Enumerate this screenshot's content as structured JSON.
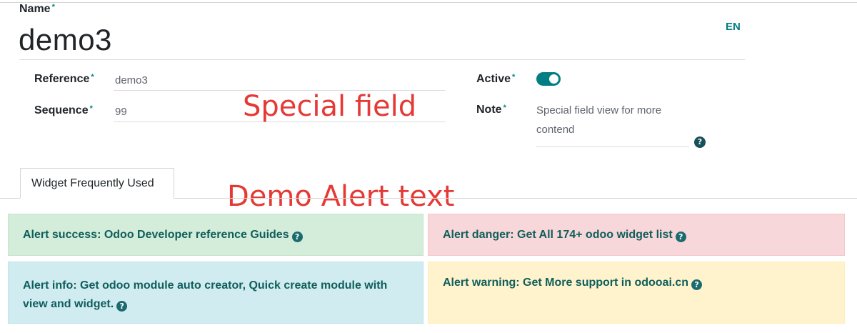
{
  "form": {
    "name_label": "Name",
    "name_value": "demo3",
    "lang_button": "EN",
    "required_marker": "*",
    "fields": {
      "reference": {
        "label": "Reference",
        "value": "demo3"
      },
      "sequence": {
        "label": "Sequence",
        "value": "99"
      },
      "active": {
        "label": "Active",
        "value": true
      },
      "note": {
        "label": "Note",
        "value_line1": "Special field view for more",
        "value_line2": "contend"
      }
    }
  },
  "annotations": {
    "special_field": "Special field",
    "demo_alert": "Demo Alert text"
  },
  "tabs": [
    {
      "label": "Widget Frequently Used",
      "active": true
    }
  ],
  "alerts": {
    "success": "Alert success: Odoo Developer reference Guides",
    "danger": "Alert danger: Get All 174+ odoo widget list",
    "info": "Alert info: Get odoo module auto creator, Quick create module with view and widget.",
    "warning": "Alert warning: Get More support in odooai.cn"
  },
  "icons": {
    "help": "question-circle-icon"
  },
  "colors": {
    "accent": "#017e84",
    "overlay_text": "#e53935",
    "success_bg": "#d4edda",
    "danger_bg": "#f8d7da",
    "info_bg": "#d1ecf1",
    "warning_bg": "#fff3cd"
  }
}
